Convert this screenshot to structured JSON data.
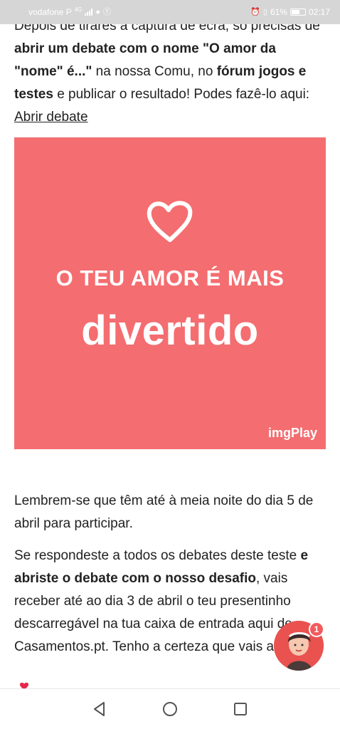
{
  "status_bar": {
    "carrier": "vodafone P",
    "network": "4G",
    "battery": "61%",
    "time": "02:17",
    "icons": [
      "signal-icon",
      "chat-bubble-icon",
      "facebook-icon",
      "alarm-icon",
      "vibrate-icon",
      "battery-icon"
    ]
  },
  "article": {
    "p1": {
      "t1": "Depois de tirares a captura de ecrã, só precisas de ",
      "b1": "abrir um debate com o nome \"O amor da \"nome\" é...\"",
      "t2": " na nossa Comu, no ",
      "b2": "fórum jogos e testes",
      "t3": " e publicar o resultado! Podes fazê-lo aqui: ",
      "link": "Abrir debate"
    },
    "banner": {
      "line1": "O TEU AMOR É MAIS",
      "line2": "divertido",
      "brand": "imgPlay",
      "background": "#f46d70"
    },
    "p2": "Lembrem-se que têm até à meia noite do dia 5 de abril para participar.",
    "p3": {
      "t1": "Se respondeste a todos os debates deste teste ",
      "b1": "e abriste o debate com o nosso desafio",
      "t2": ", vais receber até ao dia 3 de abril o teu presentinho descarregável na tua caixa de entrada aqui de Casamentos.pt. Tenho a certeza que vais adorar"
    }
  },
  "assistant": {
    "badge_count": "1"
  },
  "navbar": {
    "back": "back-triangle-icon",
    "home": "home-circle-icon",
    "recents": "recents-square-icon"
  }
}
